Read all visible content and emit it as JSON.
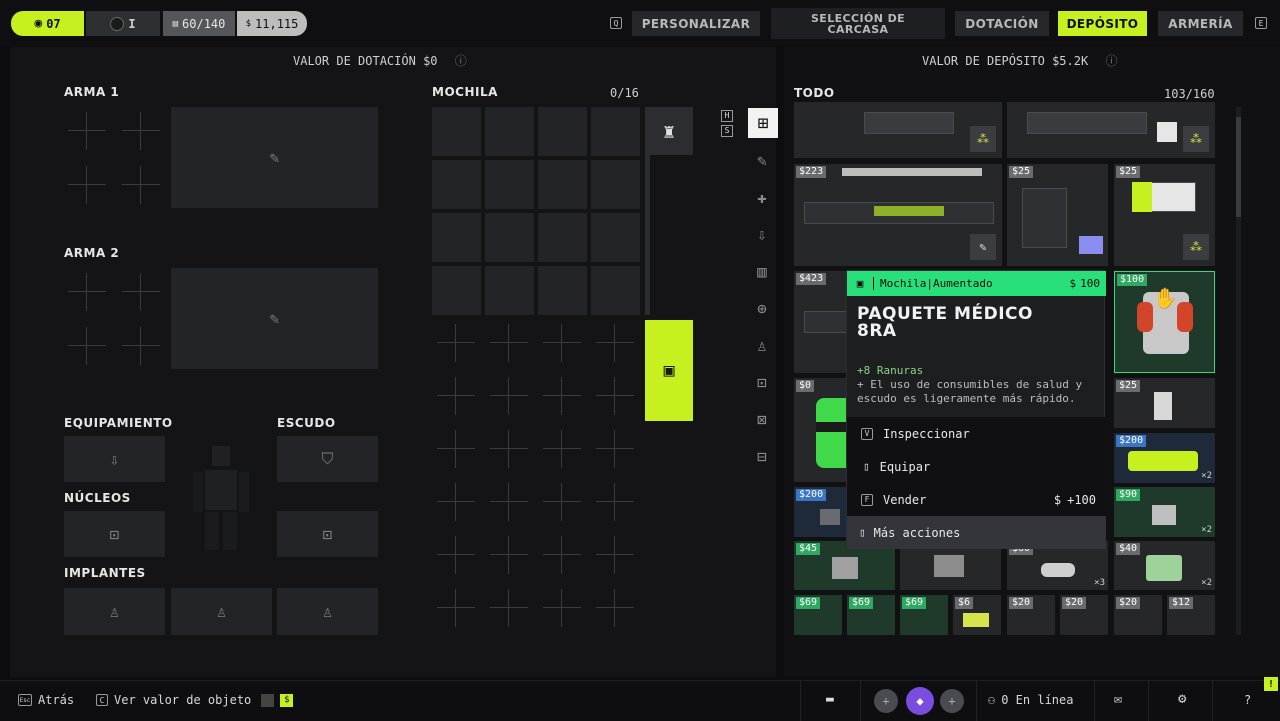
{
  "topbar": {
    "level": "07",
    "rank": "I",
    "capacity": "60/140",
    "credits": "11,115",
    "personalize_key": "Q",
    "tabs": {
      "personalize": "PERSONALIZAR",
      "shell_line1": "SELECCIÓN DE",
      "shell_line2": "CARCASA",
      "loadout": "DOTACIÓN",
      "deposit": "DEPÓSITO",
      "armory": "ARMERÍA"
    },
    "armory_key": "E"
  },
  "left": {
    "loadout_value_label": "VALOR DE DOTACIÓN",
    "loadout_value": "0",
    "weapon1": "ARMA 1",
    "weapon2": "ARMA 2",
    "backpack": "MOCHILA",
    "backpack_count": "0/16",
    "equipment": "EQUIPAMIENTO",
    "shield": "ESCUDO",
    "cores": "NÚCLEOS",
    "implants": "IMPLANTES",
    "key_h": "H",
    "key_s": "S"
  },
  "right": {
    "deposit_value_label": "VALOR DE DEPÓSITO",
    "deposit_value": "5.2K",
    "all": "TODO",
    "count": "103/160",
    "items": {
      "p223": "223",
      "p25a": "25",
      "p25b": "25",
      "p423": "423",
      "p100": "100",
      "p0": "0",
      "p25c": "25",
      "p200a": "200",
      "p200b": "200",
      "p90": "90",
      "p45": "45",
      "p40": "40",
      "p60": "60",
      "p69a": "69",
      "p69b": "69",
      "p69c": "69",
      "p6": "6",
      "p20a": "20",
      "p20b": "20",
      "p20c": "20",
      "p12": "12",
      "x2a": "×2",
      "x2b": "×2",
      "x2c": "×2",
      "x3": "×3"
    }
  },
  "tooltip": {
    "category": "Mochila|Aumentado",
    "price": "100",
    "title_line1": "PAQUETE MÉDICO",
    "title_line2": "8RA",
    "stat": "+8 Ranuras",
    "desc": "+ El uso de consumibles de salud y escudo es ligeramente más rápido.",
    "actions": {
      "inspect_key": "V",
      "inspect": "Inspeccionar",
      "equip": "Equipar",
      "sell_key": "F",
      "sell": "Vender",
      "sell_value": "+100",
      "more": "Más acciones"
    }
  },
  "bottombar": {
    "back_key": "Esc",
    "back": "Atrás",
    "value_key": "C",
    "value": "Ver valor de objeto",
    "online": "0 En línea",
    "help": "?"
  },
  "colors": {
    "accent": "#c6f01e",
    "rarity_green": "#27e07a",
    "rarity_blue": "#3b76c4"
  }
}
